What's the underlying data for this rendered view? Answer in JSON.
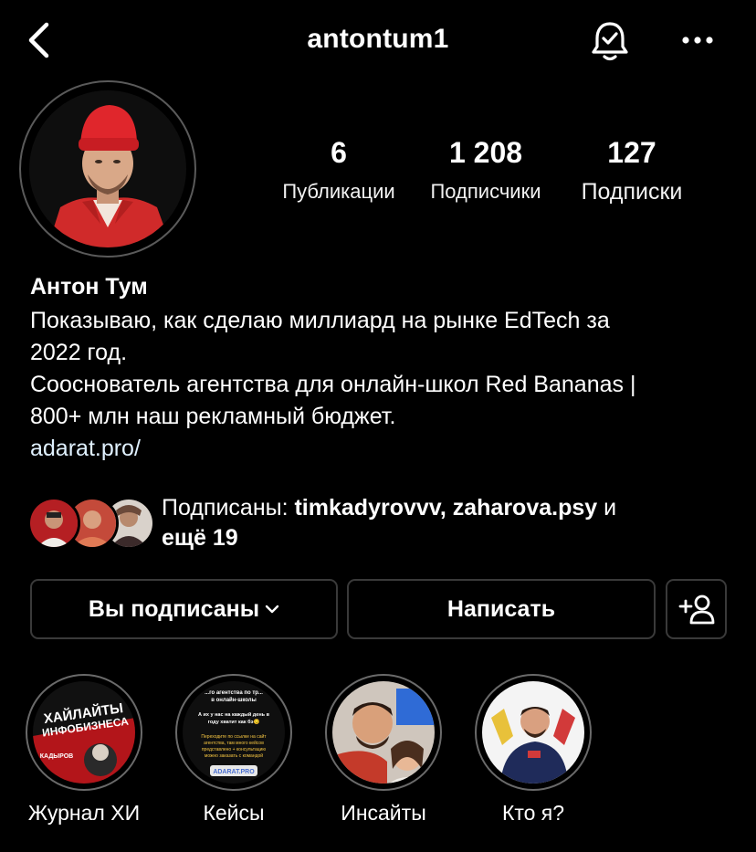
{
  "header": {
    "username": "antontum1",
    "back_icon": "chevron-left-icon",
    "bell_icon": "bell-check-icon",
    "more_icon": "ellipsis-icon"
  },
  "stats": {
    "posts": {
      "value": "6",
      "label": "Публикации"
    },
    "followers": {
      "value": "1 208",
      "label": "Подписчики"
    },
    "following": {
      "value": "127",
      "label": "Подписки"
    }
  },
  "bio": {
    "name": "Антон Тум",
    "line1": "Показываю, как сделаю миллиард на рынке EdTech за",
    "line2": "2022 год.",
    "line3": "Сооснователь агентства для онлайн-школ Red Bananas |",
    "line4": "800+ млн наш рекламный бюджет.",
    "link": "adarat.pro/"
  },
  "followed_by": {
    "prefix": "Подписаны: ",
    "user1": "timkadyrovvv",
    "sep": ", ",
    "user2": "zaharova.psy",
    "and": " и",
    "more": "ещё 19"
  },
  "actions": {
    "following_label": "Вы подписаны",
    "message_label": "Написать",
    "add_icon": "add-person-icon"
  },
  "highlights": [
    {
      "label": "Журнал ХИ",
      "cover_title_1": "ХАЙЛАЙТЫ",
      "cover_title_2": "ИНФОБИЗНЕСА",
      "cover_name": "КАДЫРОВ"
    },
    {
      "label": "Кейсы",
      "cover_line1": "...го агентства по тр...",
      "cover_line2": "в онлайн-школы",
      "cover_line3": "А их у нас на каждый день в",
      "cover_line4": "году хватит как бэ😏",
      "cover_line5": "Переходите по ссылке на сайт",
      "cover_line6": "агентства, там много кейсов",
      "cover_line7": "представлено + консультацию",
      "cover_line8": "можно заказать с командой",
      "cover_tag": "ADARAT.PRO"
    },
    {
      "label": "Инсайты"
    },
    {
      "label": "Кто я?"
    }
  ],
  "colors": {
    "background": "#000000",
    "text": "#ffffff",
    "link": "#e0f1ff",
    "border": "#3a3a3a",
    "avatar_hat": "#d8262b"
  }
}
